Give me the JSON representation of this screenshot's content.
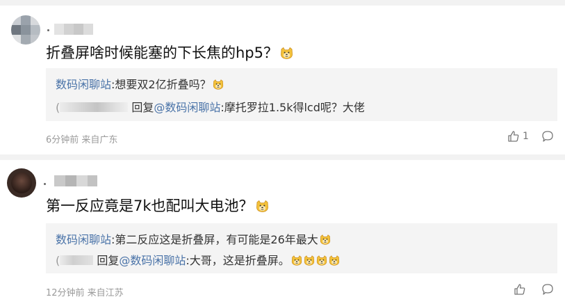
{
  "comments": [
    {
      "text": "折叠屏啥时候能塞的下长焦的hp5？",
      "reply_text": "想要双2亿折叠吗？",
      "reply_author": "数码闲聊站",
      "sub_reply_prefix": "回复",
      "sub_reply_mention": "@数码闲聊站",
      "sub_reply_text": ":摩托罗拉1.5k得lcd呢？大佬",
      "meta": "6分钟前 来自广东",
      "like_count": "1"
    },
    {
      "text": "第一反应竟是7k也配叫大电池？",
      "reply_text": "第二反应这是折叠屏，有可能是26年最大",
      "reply_author": "数码闲聊站",
      "sub_reply_prefix": "回复",
      "sub_reply_mention": "@数码闲聊站",
      "sub_reply_text": ":大哥，这是折叠屏。",
      "meta": "12分钟前 来自江苏",
      "like_count": ""
    }
  ],
  "icons": {
    "emoji": "doge-emoji-icon",
    "like": "thumbs-up-icon",
    "comment": "comment-bubble-icon"
  },
  "colors": {
    "link": "#4a73a8",
    "meta": "#9a9a9a",
    "quote_bg": "#f4f4f4",
    "emoji": "#f3c13a"
  }
}
